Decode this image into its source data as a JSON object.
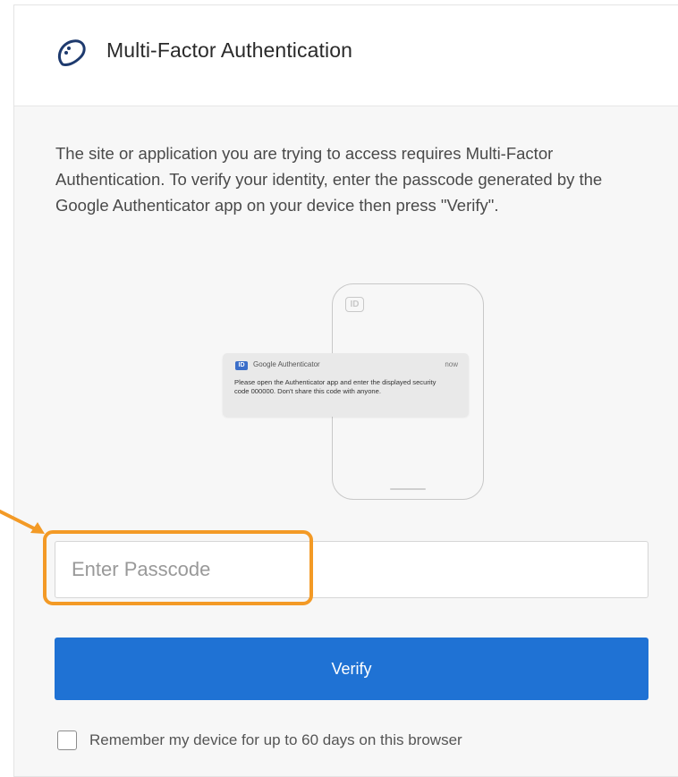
{
  "header": {
    "title": "Multi-Factor Authentication",
    "logo_icon": "infinity-swirl-icon"
  },
  "body": {
    "description": "The site or application you are trying to access requires Multi-Factor Authentication. To verify your identity, enter the passcode generated by the Google Authenticator app on your device then press \"Verify\".",
    "illustration": {
      "phone_badge": "ID",
      "notification": {
        "badge": "ID",
        "app_name": "Google Authenticator",
        "time": "now",
        "message": "Please open the Authenticator app and enter the displayed security code 000000. Don't share this code with anyone."
      }
    },
    "passcode": {
      "value": "",
      "placeholder": "Enter Passcode"
    },
    "verify_button": "Verify",
    "remember": {
      "label": "Remember my device for up to 60 days on this browser",
      "checked": false
    }
  },
  "colors": {
    "primary_button": "#1f72d4",
    "highlight": "#f39a26",
    "body_background": "#f7f7f7"
  }
}
